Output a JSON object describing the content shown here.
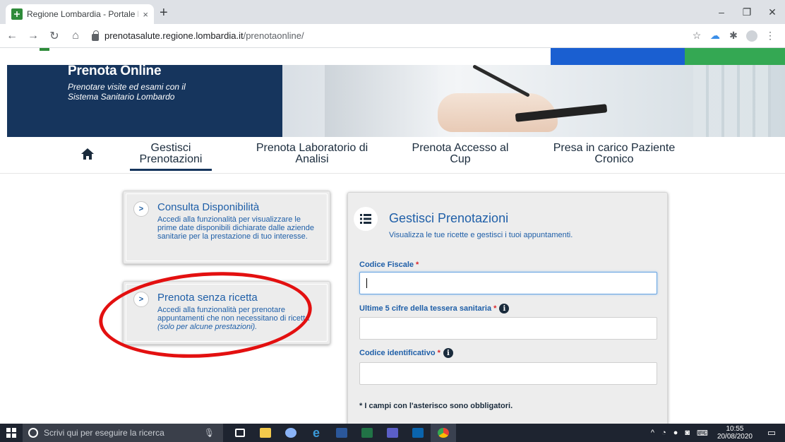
{
  "browser": {
    "tab_title": "Regione Lombardia - Portale Pre",
    "tab_close": "×",
    "new_tab": "+",
    "url_host": "prenotasalute.regione.lombardia.it",
    "url_path": "/prenotaonline/",
    "window_minimize": "–",
    "window_maximize": "❐",
    "window_close": "✕"
  },
  "banner": {
    "title": "Prenota Online",
    "subtitle": "Prenotare visite ed esami con il Sistema Sanitario Lombardo"
  },
  "nav": {
    "items": [
      {
        "line1": "Gestisci",
        "line2": "Prenotazioni",
        "active": true
      },
      {
        "line1": "Prenota Laboratorio di",
        "line2": "Analisi",
        "active": false
      },
      {
        "line1": "Prenota Accesso al",
        "line2": "Cup",
        "active": false
      },
      {
        "line1": "Presa in carico Paziente",
        "line2": "Cronico",
        "active": false
      }
    ]
  },
  "cards": [
    {
      "chevron": ">",
      "title": "Consulta Disponibilità",
      "description": "Accedi alla funzionalità per visualizzare le prime date disponibili dichiarate dalle aziende sanitarie per la prestazione di tuo interesse."
    },
    {
      "chevron": ">",
      "title": "Prenota senza ricetta",
      "description": "Accedi alla funzionalità per prenotare appuntamenti che non necessitano di ricetta",
      "description_italic": "(solo per alcune prestazioni)."
    }
  ],
  "form": {
    "title": "Gestisci Prenotazioni",
    "subtitle": "Visualizza le tue ricette e gestisci i tuoi appuntamenti.",
    "fields": [
      {
        "label": "Codice Fiscale",
        "required": "*",
        "value": ""
      },
      {
        "label": "Ultime 5 cifre della tessera sanitaria",
        "required": "*",
        "value": ""
      },
      {
        "label": "Codice identificativo",
        "required": "*",
        "value": ""
      }
    ],
    "info_glyph": "i",
    "note": "* I campi con l'asterisco sono obbligatori."
  },
  "taskbar": {
    "search_placeholder": "Scrivi qui per eseguire la ricerca",
    "time": "10:55",
    "date": "20/08/2020"
  },
  "colors": {
    "banner_navy": "#16355d",
    "link_blue": "#1f5fa8",
    "annotation_red": "#e31010",
    "bar_blue": "#1a5fd1",
    "bar_green": "#34a853"
  }
}
